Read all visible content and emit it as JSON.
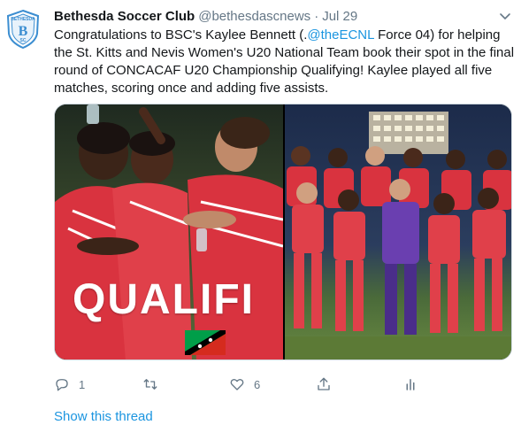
{
  "tweet": {
    "author_name": "Bethesda Soccer Club",
    "handle": "@bethesdascnews",
    "separator": "·",
    "date": "Jul 29",
    "avatar_text": "BETHESDA",
    "avatar_letter": "B",
    "avatar_sub": "SC",
    "text_lines": [
      {
        "before": "Congratulations to BSC's Kaylee Bennett (.",
        "mention": "@theECNL",
        "after": "  Force 04) for helping"
      },
      {
        "before": "the St. Kitts and Nevis Women's U20 National Team book their spot in the final",
        "mention": "",
        "after": ""
      },
      {
        "before": "round of CONCACAF U20 Championship Qualifying! Kaylee played all five",
        "mention": "",
        "after": ""
      },
      {
        "before": "matches, scoring once and adding five assists.",
        "mention": "",
        "after": ""
      }
    ],
    "media": {
      "overlay_word": "QUALIFI"
    },
    "actions": {
      "reply_count": "1",
      "retweet_count": "",
      "like_count": "6"
    },
    "show_thread": "Show this thread"
  },
  "colors": {
    "link": "#1b95e0",
    "secondary_text": "#657786",
    "jersey_red": "#d9333f",
    "avatar_blue": "#3c8ed1"
  }
}
